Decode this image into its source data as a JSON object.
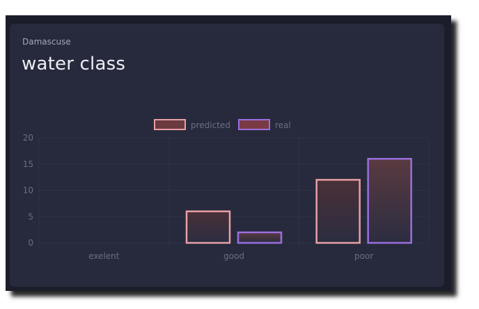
{
  "card": {
    "subtitle": "Damascuse",
    "title": "water class"
  },
  "chart_data": {
    "type": "bar",
    "categories": [
      "exelent",
      "good",
      "poor"
    ],
    "series": [
      {
        "name": "predicted",
        "values": [
          0,
          6,
          12
        ],
        "border_color": "#e8a0a6",
        "fill_top": "#4a3038",
        "fill_bottom": "#2b2d40"
      },
      {
        "name": "real",
        "values": [
          0,
          2,
          16
        ],
        "border_color": "#9a6fe0",
        "fill_top": "#5a3a40",
        "fill_bottom": "#2b2d40"
      }
    ],
    "ylim": [
      0,
      20
    ],
    "yticks": [
      0,
      5,
      10,
      15,
      20
    ],
    "legend_position": "top",
    "grid": true,
    "grid_color": "#2f3245"
  }
}
